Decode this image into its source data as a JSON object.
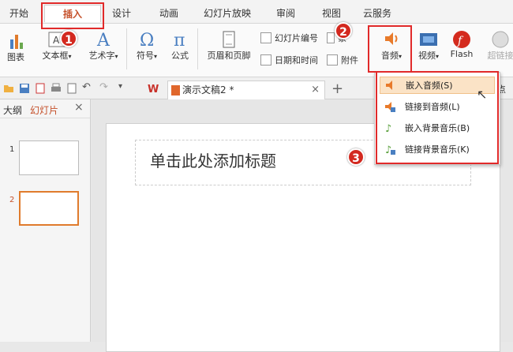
{
  "menu": {
    "tabs": [
      "开始",
      "插入",
      "设计",
      "动画",
      "幻灯片放映",
      "审阅",
      "视图",
      "云服务"
    ]
  },
  "ribbon": {
    "chart": "图表",
    "textbox": "文本框",
    "wordart": "艺术字",
    "symbol": "符号",
    "formula": "公式",
    "header_footer": "页眉和页脚",
    "slide_number": "幻灯片编号",
    "date_time": "日期和时间",
    "object": "象",
    "attachment": "附件",
    "audio": "音频",
    "video": "视频",
    "flash": "Flash",
    "hyperlink": "超链接"
  },
  "quickbar": {
    "doc_tab": "演示文稿2 *",
    "right_text": "点"
  },
  "left_panel": {
    "tab_outline": "大纲",
    "tab_slides": "幻灯片",
    "slide_numbers": [
      "1",
      "2"
    ]
  },
  "slide": {
    "title_placeholder": "单击此处添加标题"
  },
  "audio_menu": {
    "items": [
      "嵌入音频(S)",
      "链接到音频(L)",
      "嵌入背景音乐(B)",
      "链接背景音乐(K)"
    ]
  },
  "annotations": {
    "step1": "1",
    "step2": "2",
    "step3": "3"
  },
  "colors": {
    "accent": "#c5502a",
    "highlight_red": "#e12a2a",
    "audio_orange": "#e87a2a"
  }
}
